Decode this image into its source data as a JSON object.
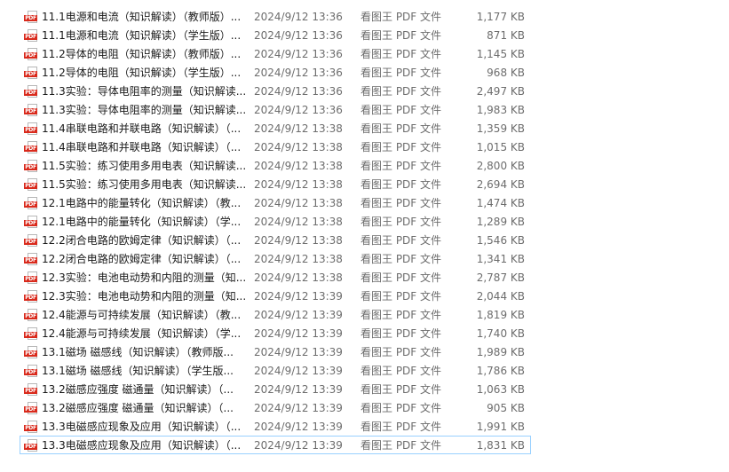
{
  "files": [
    {
      "name": "11.1电源和电流（知识解读）（教师版）...",
      "date": "2024/9/12 13:36",
      "type": "看图王 PDF 文件",
      "size": "1,177 KB"
    },
    {
      "name": "11.1电源和电流（知识解读）（学生版）...",
      "date": "2024/9/12 13:36",
      "type": "看图王 PDF 文件",
      "size": "871 KB"
    },
    {
      "name": "11.2导体的电阻（知识解读）（教师版）...",
      "date": "2024/9/12 13:36",
      "type": "看图王 PDF 文件",
      "size": "1,145 KB"
    },
    {
      "name": "11.2导体的电阻（知识解读）（学生版）...",
      "date": "2024/9/12 13:36",
      "type": "看图王 PDF 文件",
      "size": "968 KB"
    },
    {
      "name": "11.3实验：导体电阻率的测量（知识解读...",
      "date": "2024/9/12 13:36",
      "type": "看图王 PDF 文件",
      "size": "2,497 KB"
    },
    {
      "name": "11.3实验：导体电阻率的测量（知识解读...",
      "date": "2024/9/12 13:36",
      "type": "看图王 PDF 文件",
      "size": "1,983 KB"
    },
    {
      "name": "11.4串联电路和并联电路（知识解读）（...",
      "date": "2024/9/12 13:38",
      "type": "看图王 PDF 文件",
      "size": "1,359 KB"
    },
    {
      "name": "11.4串联电路和并联电路（知识解读）（...",
      "date": "2024/9/12 13:38",
      "type": "看图王 PDF 文件",
      "size": "1,015 KB"
    },
    {
      "name": "11.5实验：练习使用多用电表（知识解读...",
      "date": "2024/9/12 13:38",
      "type": "看图王 PDF 文件",
      "size": "2,800 KB"
    },
    {
      "name": "11.5实验：练习使用多用电表（知识解读...",
      "date": "2024/9/12 13:38",
      "type": "看图王 PDF 文件",
      "size": "2,694 KB"
    },
    {
      "name": "12.1电路中的能量转化（知识解读）（教...",
      "date": "2024/9/12 13:38",
      "type": "看图王 PDF 文件",
      "size": "1,474 KB"
    },
    {
      "name": "12.1电路中的能量转化（知识解读）（学...",
      "date": "2024/9/12 13:38",
      "type": "看图王 PDF 文件",
      "size": "1,289 KB"
    },
    {
      "name": "12.2闭合电路的欧姆定律（知识解读）（...",
      "date": "2024/9/12 13:38",
      "type": "看图王 PDF 文件",
      "size": "1,546 KB"
    },
    {
      "name": "12.2闭合电路的欧姆定律（知识解读）（...",
      "date": "2024/9/12 13:38",
      "type": "看图王 PDF 文件",
      "size": "1,341 KB"
    },
    {
      "name": "12.3实验：电池电动势和内阻的测量（知...",
      "date": "2024/9/12 13:38",
      "type": "看图王 PDF 文件",
      "size": "2,787 KB"
    },
    {
      "name": "12.3实验：电池电动势和内阻的测量（知...",
      "date": "2024/9/12 13:39",
      "type": "看图王 PDF 文件",
      "size": "2,044 KB"
    },
    {
      "name": "12.4能源与可持续发展（知识解读）（教...",
      "date": "2024/9/12 13:39",
      "type": "看图王 PDF 文件",
      "size": "1,819 KB"
    },
    {
      "name": "12.4能源与可持续发展（知识解读）（学...",
      "date": "2024/9/12 13:39",
      "type": "看图王 PDF 文件",
      "size": "1,740 KB"
    },
    {
      "name": "13.1磁场 磁感线（知识解读）（教师版...",
      "date": "2024/9/12 13:39",
      "type": "看图王 PDF 文件",
      "size": "1,989 KB"
    },
    {
      "name": "13.1磁场 磁感线（知识解读）（学生版...",
      "date": "2024/9/12 13:39",
      "type": "看图王 PDF 文件",
      "size": "1,786 KB"
    },
    {
      "name": "13.2磁感应强度 磁通量（知识解读）（...",
      "date": "2024/9/12 13:39",
      "type": "看图王 PDF 文件",
      "size": "1,063 KB"
    },
    {
      "name": "13.2磁感应强度 磁通量（知识解读）（...",
      "date": "2024/9/12 13:39",
      "type": "看图王 PDF 文件",
      "size": "905 KB"
    },
    {
      "name": "13.3电磁感应现象及应用（知识解读）（...",
      "date": "2024/9/12 13:39",
      "type": "看图王 PDF 文件",
      "size": "1,991 KB"
    },
    {
      "name": "13.3电磁感应现象及应用（知识解读）（...",
      "date": "2024/9/12 13:39",
      "type": "看图王 PDF 文件",
      "size": "1,831 KB"
    }
  ],
  "icon": {
    "name": "pdf-file-icon",
    "label": "PDF",
    "color": "#d92a1c"
  },
  "selected_index": 23,
  "colors": {
    "selection_border": "#99d1ff",
    "secondary_text": "#6d6d6d"
  }
}
